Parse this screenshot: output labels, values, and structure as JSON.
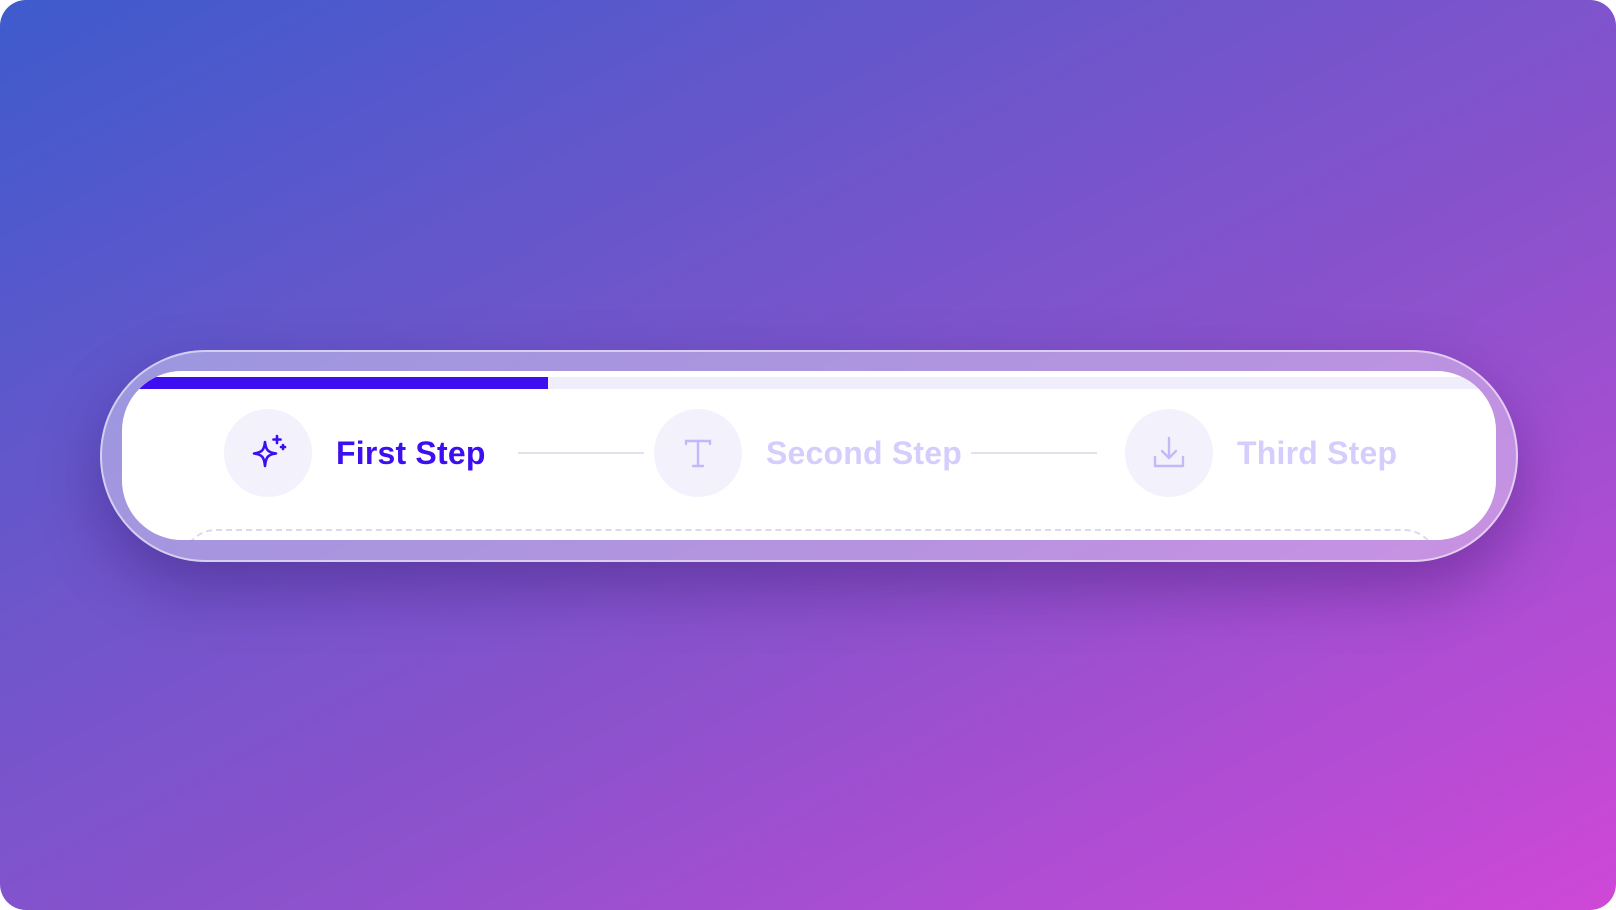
{
  "stepper": {
    "progress_percent": 31,
    "accent_color": "#3d0ff0",
    "inactive_color": "#d5cdfb",
    "steps": [
      {
        "label": "First Step",
        "icon": "sparkles-icon",
        "state": "active"
      },
      {
        "label": "Second Step",
        "icon": "text-icon",
        "state": "inactive"
      },
      {
        "label": "Third Step",
        "icon": "download-icon",
        "state": "inactive"
      }
    ]
  }
}
